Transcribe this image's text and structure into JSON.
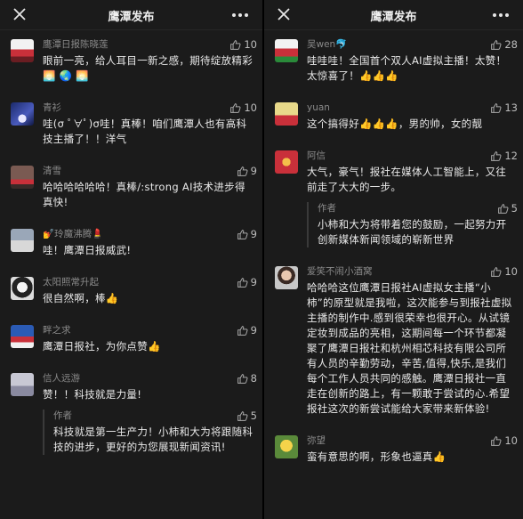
{
  "app": {
    "title": "鹰潭发布"
  },
  "left": {
    "comments": [
      {
        "name": "鹰潭日报陈晓莲",
        "likes": "10",
        "text": "眼前一亮，给人耳目一新之感，期待绽放精彩🌅 🌏 🌅"
      },
      {
        "name": "青衫",
        "likes": "10",
        "text": "哇(σ ﾟ∀ﾟ)σ哇！真棒！咱们鹰潭人也有高科技主播了！！洋气"
      },
      {
        "name": "清雪",
        "likes": "9",
        "text": "哈哈哈哈哈哈！真棒/:strong AI技术进步得真快!"
      },
      {
        "name": "💅玲魔沸腾💄",
        "likes": "9",
        "text": "哇！鹰潭日报威武!"
      },
      {
        "name": "太阳照常升起",
        "likes": "9",
        "text": "很自然啊，棒👍"
      },
      {
        "name": "畔之求",
        "likes": "9",
        "text": "鹰潭日报社，为你点赞👍"
      },
      {
        "name": "信人远游",
        "likes": "8",
        "text": "赞！！科技就是力量!",
        "reply": {
          "name": "作者",
          "likes": "5",
          "text": "科技就是第一生产力！小柿和大为将跟随科技的进步，更好的为您展现新闻资讯!"
        }
      }
    ]
  },
  "right": {
    "comments": [
      {
        "name": "吴wen🐬",
        "likes": "28",
        "text": "哇哇哇！全国首个双人AI虚拟主播！太赞！太惊喜了！👍👍👍"
      },
      {
        "name": "yuan",
        "likes": "13",
        "text": "这个搞得好👍👍👍，男的帅，女的靓"
      },
      {
        "name": "阿信",
        "likes": "12",
        "text": "大气，豪气！报社在媒体人工智能上，又往前走了大大的一步。",
        "reply": {
          "name": "作者",
          "likes": "5",
          "text": "小柿和大为将带着您的鼓励，一起努力开创新媒体新闻领域的崭新世界"
        }
      },
      {
        "name": "爱笑不闹小酒窝",
        "likes": "10",
        "text": "哈哈哈这位鹰潭日报社AI虚拟女主播“小柿”的原型就是我啦，这次能参与到报社虚拟主播的制作中.感到很荣幸也很开心。从试镜定妆到成品的亮相，这期间每一个环节都凝聚了鹰潭日报社和杭州相芯科技有限公司所有人员的辛勤劳动，辛苦,值得,快乐,是我们每个工作人员共同的感触。鹰潭日报社一直走在创新的路上，有一颗敢于尝试的心.希望报社这次的新尝试能给大家带来新体验!"
      },
      {
        "name": "弥望",
        "likes": "10",
        "text": "蛮有意思的啊，形象也逼真👍"
      }
    ]
  },
  "colors": {
    "background": "#1b1b1b",
    "text": "#e9e9e9",
    "meta": "#8a8a8a",
    "divider": "#3a3a3a"
  },
  "icons": {
    "close": "close-icon",
    "more": "more-icon",
    "like": "thumbs-up-icon"
  }
}
